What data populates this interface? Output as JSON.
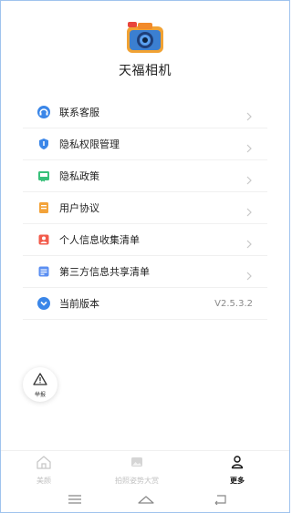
{
  "app": {
    "name": "天福相机",
    "icon": "camera-app-icon"
  },
  "menu": [
    {
      "label": "联系客服",
      "icon": "customer-service-icon",
      "color": "#3a86e8"
    },
    {
      "label": "隐私权限管理",
      "icon": "shield-icon",
      "color": "#3a86e8"
    },
    {
      "label": "隐私政策",
      "icon": "book-icon",
      "color": "#39c07a"
    },
    {
      "label": "用户协议",
      "icon": "document-icon",
      "color": "#f3a33a"
    },
    {
      "label": "个人信息收集清单",
      "icon": "profile-card-icon",
      "color": "#f25b4b"
    },
    {
      "label": "第三方信息共享清单",
      "icon": "list-icon",
      "color": "#5b8ff2"
    },
    {
      "label": "当前版本",
      "icon": "chevron-down-circle-icon",
      "color": "#3a86e8",
      "value": "V2.5.3.2"
    }
  ],
  "report": {
    "label": "举报"
  },
  "tabs": [
    {
      "label": "美颜",
      "icon": "home-icon",
      "active": false
    },
    {
      "label": "拍照姿势大赏",
      "icon": "image-icon",
      "active": false
    },
    {
      "label": "更多",
      "icon": "person-icon",
      "active": true
    }
  ],
  "colors": {
    "accent": "#3a86e8",
    "border": "#9fc3ee",
    "inactive": "#c2c2c2"
  }
}
